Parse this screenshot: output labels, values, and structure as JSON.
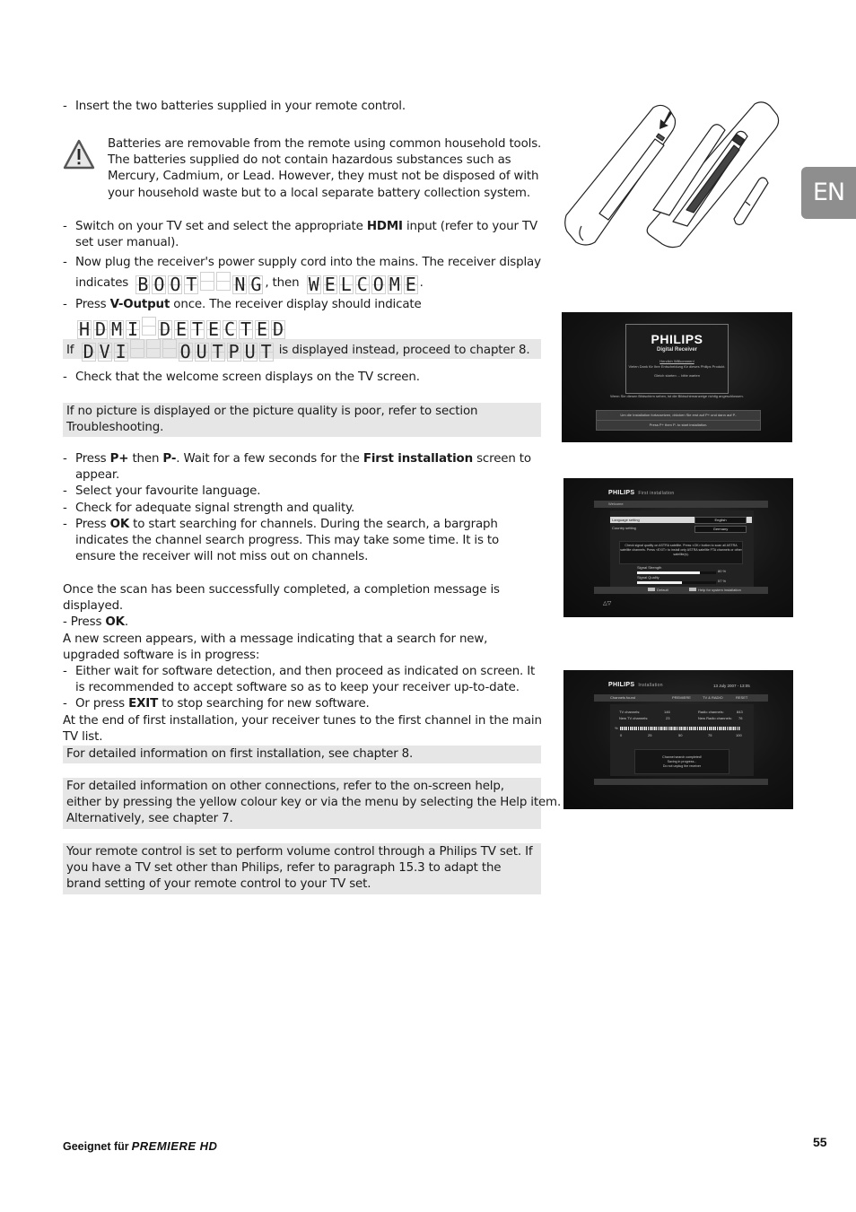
{
  "lang_tab": "EN",
  "page_number": "55",
  "footer": {
    "label": "Geeignet für",
    "brand": "PREMIERE HD"
  },
  "steps": {
    "insert_batteries": "Insert the two batteries supplied in your remote control.",
    "warning": "Batteries are removable from the remote using common household tools. The batteries supplied do not contain hazardous substances such as Mercury, Cadmium, or Lead. However, they must not be disposed of with your household waste but to a local separate battery collection system.",
    "switch_on_pre": "Switch on your TV set and select the appropriate ",
    "switch_on_bold": "HDMI",
    "switch_on_post": " input (refer to your TV set user manual).",
    "plug_in": "Now plug the receiver's power supply cord into the mains. The receiver display",
    "indicates": "indicates",
    "then": ", then",
    "period": ".",
    "press_pre": "Press ",
    "press_bold": "V-Output",
    "press_post": " once. The receiver display should indicate",
    "check_welcome": "Check that the welcome screen displays on the TV screen."
  },
  "lcd": {
    "booting": [
      "B",
      "O",
      "O",
      "T",
      "",
      "",
      "N",
      "G"
    ],
    "welcome": [
      "W",
      "E",
      "L",
      "C",
      "O",
      "M",
      "E"
    ],
    "hdmi_detected": [
      "H",
      "D",
      "M",
      "I",
      "",
      "D",
      "E",
      "T",
      "E",
      "C",
      "T",
      "E",
      "D"
    ],
    "dvi_output": [
      "D",
      "V",
      "I",
      "",
      "",
      "",
      "O",
      "U",
      "T",
      "P",
      "U",
      "T"
    ]
  },
  "notes": {
    "dvi_pre": "If",
    "dvi_post": "is displayed instead, proceed to chapter 8.",
    "no_picture": "If no picture is displayed or the picture quality is poor, refer to section Troubleshooting.",
    "first_install": "For detailed information on first installation, see chapter 8.",
    "other_connections_1": "For detailed information on other connections, refer to the on-screen help,",
    "other_connections_2": "either by pressing the yellow colour key or via the menu by selecting the Help item.",
    "other_connections_3": "Alternatively, see chapter 7.",
    "remote_volume": "Your remote control is set to perform volume control through a Philips TV set. If you have a TV set other than Philips, refer to paragraph 15.3 to adapt the brand setting of your remote control to your TV set."
  },
  "install": {
    "p_pre": "Press ",
    "p_plus": "P+",
    "p_then": " then ",
    "p_minus": "P-",
    "p_wait": ". Wait for a few seconds for the ",
    "p_first": "First installation",
    "p_post": " screen to appear.",
    "language": "Select your favourite language.",
    "signal": "Check for adequate signal strength and quality.",
    "ok_pre": "Press ",
    "ok_bold": "OK",
    "ok_post": " to start searching for channels. During the search, a bargraph indicates the channel search progress. This may take some time. It is to ensure the receiver will not miss out on channels."
  },
  "completion": {
    "line1": "Once the scan has been successfully completed, a completion message is displayed.",
    "press": "- Press ",
    "press_bold": "OK",
    "press_end": ".",
    "line3": "A new screen appears, with a message indicating that a search for new, upgraded software is in progress:",
    "either": "Either wait for software detection, and then proceed as indicated on screen. It is recommended to accept software so as to keep your receiver up-to-date.",
    "or_pre": "Or press ",
    "or_bold": "EXIT",
    "or_post": " to stop searching for new software.",
    "end": "At the end of first installation, your receiver tunes to the first channel in the main TV list."
  },
  "tv_welcome": {
    "brand": "PHILIPS",
    "subtitle": "Digital Receiver",
    "greeting": "Herzlich Willkommen!",
    "thanks": "Vielen Dank für Ihre Entscheidung für dieses Philips Produkt.",
    "start": "Gleich starten ... bitte warten",
    "hint": "Wenn Sie diesen Bildschirm sehen, ist die Bildschirmanzeige richtig angeschlossen.",
    "bar1": "Um die Installation fortzusetzen, drücken Sie erst auf P+ und dann auf P-",
    "bar2": "Press P+ then P- to start installation."
  },
  "tv_first_install": {
    "brand": "PHILIPS",
    "title": "First installation",
    "strip": "Welcome",
    "language_label": "Language setting",
    "language_value": "English",
    "country_label": "Country setting",
    "country_value": "Germany",
    "message": "Check signal quality on ASTRA satellite. Press <OK> button to scan all ASTRA satellite channels. Press <EXIT> to install only ASTRA satellite FTA channels or other satellite(s).",
    "strength_label": "Signal Strength",
    "strength_value": "80 %",
    "strength_level": 0.8,
    "quality_label": "Signal Quality",
    "quality_value": "57 %",
    "quality_level": 0.57,
    "default_label": "Default",
    "help_label": "Help for system installation"
  },
  "tv_installation": {
    "brand": "PHILIPS",
    "title": "Installation",
    "datetime": "13 July 2007 - 13:05",
    "tabs": [
      "Channels found",
      "PREMIERE",
      "TV & RADIO",
      "RESET"
    ],
    "tv_channels_label": "TV channels:",
    "tv_channels_value": "146",
    "new_tv_label": "New TV channels:",
    "new_tv_value": "23",
    "radio_channels_label": "Radio channels:",
    "radio_channels_value": "843",
    "new_radio_label": "New Radio channels:",
    "new_radio_value": "76",
    "progress_unit": "%",
    "progress_ticks": [
      "0",
      "25",
      "50",
      "75",
      "100"
    ],
    "progress_level": 1.0,
    "msg1": "Channel search completed!",
    "msg2": "Saving in progress...",
    "msg3": "Do not unplug the receiver"
  }
}
